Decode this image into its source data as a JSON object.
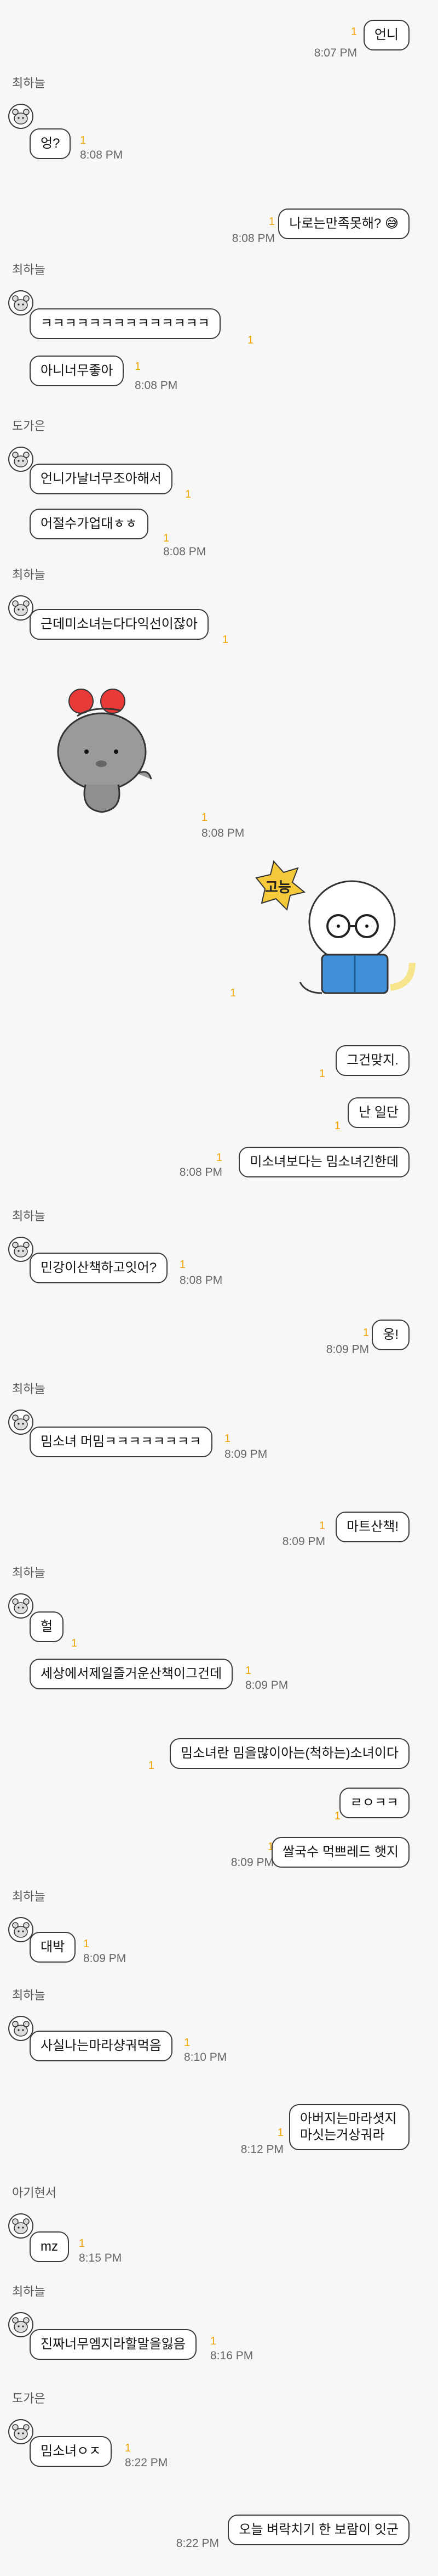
{
  "colors": {
    "background": "#f7f7f7",
    "bubble_bg": "#ffffff",
    "bubble_border": "#3a3a3a",
    "unread": "#f0a500",
    "time": "#666666"
  },
  "messages": [
    {
      "text": "언니",
      "unread": "1",
      "time": "8:07 PM"
    },
    {
      "sender": "최하늘",
      "text": "엉?",
      "unread": "1",
      "time": "8:08 PM"
    },
    {
      "text": "나로는만족못해?",
      "emoji": "😅",
      "unread": "1",
      "time": "8:08 PM"
    },
    {
      "sender": "최하늘",
      "text": "ㅋㅋㅋㅋㅋㅋㅋㅋㅋㅋㅋㅋㅋㅋ",
      "unread": "1"
    },
    {
      "text": "아니너무좋아",
      "unread": "1",
      "time": "8:08 PM"
    },
    {
      "sender": "도가은",
      "text": "언니가날너무조아해서",
      "unread": "1"
    },
    {
      "text": "어절수가업대ㅎㅎ",
      "unread": "1",
      "time": "8:08 PM"
    },
    {
      "sender": "최하늘",
      "text": "근데미소녀는다다익선이잖아",
      "unread": "1"
    },
    {
      "sticker": "gray-bear-heart-sticker",
      "unread": "1",
      "time": "8:08 PM"
    },
    {
      "sticker": "glasses-dog-reading-sticker",
      "sticker_text": "고능",
      "unread": "1"
    },
    {
      "text": "그건맞지.",
      "unread": "1"
    },
    {
      "text": "난 일단",
      "unread": "1"
    },
    {
      "text": "미소녀보다는 밈소녀긴한데",
      "unread": "1",
      "time": "8:08 PM"
    },
    {
      "sender": "최하늘",
      "text": "민강이산책하고잇어?",
      "unread": "1",
      "time": "8:08 PM"
    },
    {
      "text": "웅!",
      "unread": "1",
      "time": "8:09 PM"
    },
    {
      "sender": "최하늘",
      "text": "밈소녀 머밈ㅋㅋㅋㅋㅋㅋㅋㅋ",
      "unread": "1",
      "time": "8:09 PM"
    },
    {
      "text": "마트산책!",
      "unread": "1",
      "time": "8:09 PM"
    },
    {
      "sender": "최하늘",
      "text": "헐",
      "unread": "1"
    },
    {
      "text": "세상에서제일즐거운산책이그건데",
      "unread": "1",
      "time": "8:09 PM"
    },
    {
      "text": "밈소녀란 밈을많이아는(척하는)소녀이다",
      "unread": "1"
    },
    {
      "text": "ㄹㅇㅋㅋ",
      "unread": "1"
    },
    {
      "text": "쌀국수 먹쁘레드 햇지",
      "unread": "1",
      "time": "8:09 PM"
    },
    {
      "sender": "최하늘",
      "text": "대박",
      "unread": "1",
      "time": "8:09 PM"
    },
    {
      "sender": "최하늘",
      "text": "사실나는마라샹궈먹음",
      "unread": "1",
      "time": "8:10 PM"
    },
    {
      "text": "아버지는마라셧지 마싯는거상궈라",
      "unread": "1",
      "time": "8:12 PM"
    },
    {
      "sender": "아기현서",
      "text": "mz",
      "unread": "1",
      "time": "8:15 PM"
    },
    {
      "sender": "최하늘",
      "text": "진짜너무엠지라할말을잃음",
      "unread": "1",
      "time": "8:16 PM"
    },
    {
      "sender": "도가은",
      "text": "밈소녀ㅇㅈ",
      "unread": "1",
      "time": "8:22 PM"
    },
    {
      "text": "오늘 벼락치기 한 보람이 잇군",
      "unread": "1",
      "time": "8:22 PM"
    }
  ]
}
